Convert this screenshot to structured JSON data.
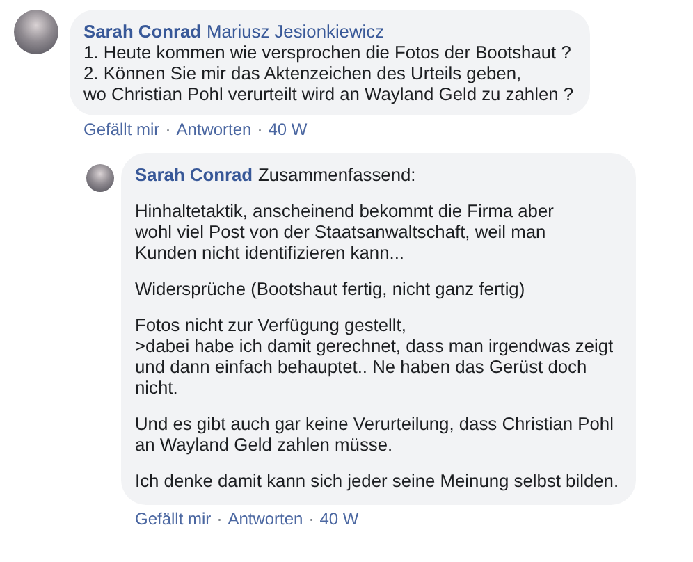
{
  "comments": [
    {
      "author": "Sarah Conrad",
      "mention": "Mariusz Jesionkiewicz",
      "paragraphs": [
        "1. Heute kommen wie versprochen die Fotos der Bootshaut ?\n2. Können Sie mir das Aktenzeichen des Urteils geben,\nwo Christian Pohl verurteilt wird an Wayland Geld zu zahlen ?"
      ],
      "actions": [
        "Gefällt mir",
        "Antworten"
      ],
      "separator": "·",
      "time": "40 W",
      "replies": [
        {
          "author": "Sarah Conrad",
          "lead": "Zusammenfassend:",
          "paragraphs": [
            "Hinhaltetaktik, anscheinend bekommt die Firma aber\nwohl viel Post von der Staatsanwaltschaft, weil man\nKunden nicht identifizieren kann...",
            "Widersprüche (Bootshaut fertig, nicht ganz fertig)",
            "Fotos nicht zur Verfügung gestellt,\n>dabei habe ich damit gerechnet, dass man irgendwas zeigt\nund dann einfach behauptet.. Ne haben das Gerüst doch\nnicht.",
            "Und es gibt auch gar keine Verurteilung, dass Christian Pohl\nan Wayland Geld zahlen müsse.",
            "Ich denke damit kann sich jeder seine Meinung selbst bilden."
          ],
          "actions": [
            "Gefällt mir",
            "Antworten"
          ],
          "separator": "·",
          "time": "40 W"
        }
      ]
    }
  ]
}
